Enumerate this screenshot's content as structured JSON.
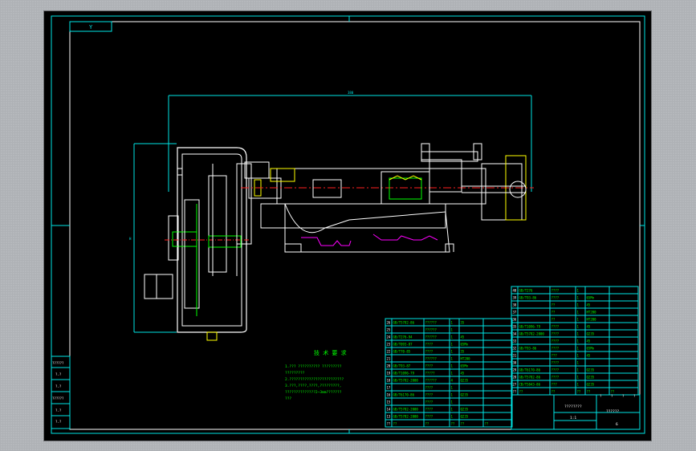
{
  "drawing": {
    "corner_label": "Y",
    "dimension_top": "380",
    "dimension_left": "H",
    "tech_title": "技 术 要 求",
    "tech_lines": [
      "1.??? ?????????? ?????????",
      "  ?????????",
      "2.?????????????????????????",
      "3.???,????,????,?????????,",
      "  ??????????????2~3mm???????",
      "  ???"
    ],
    "title_block": {
      "main_name": "????????",
      "scale_label": "1:1",
      "sheet_code": "??????",
      "right_marks": [
        "?",
        "?",
        "?",
        "?"
      ],
      "bottom_code": "6"
    },
    "left_marks": [
      "??????",
      "?.?",
      "?.?",
      "??????",
      "?.?",
      "?.?"
    ],
    "bom_left": [
      [
        "26",
        "GB/T5782-86",
        "??????",
        "1",
        "35",
        ""
      ],
      [
        "25",
        "",
        "??????",
        "1",
        "",
        ""
      ],
      [
        "24",
        "GB/T276-94",
        "??????",
        "1",
        "45",
        ""
      ],
      [
        "23",
        "GB/T093-87",
        "????",
        "1",
        "65Mn",
        ""
      ],
      [
        "22",
        "GB/T70-85",
        "????",
        "1",
        "35",
        ""
      ],
      [
        "21",
        "",
        "??????",
        "1",
        "HT200",
        ""
      ],
      [
        "20",
        "GB/T93-87",
        "????",
        "1",
        "65Mn",
        ""
      ],
      [
        "19",
        "GB/T1096-79",
        "?????",
        "1",
        "45",
        ""
      ],
      [
        "18",
        "GB/T5782-2000",
        "??????",
        "4",
        "Q235",
        ""
      ],
      [
        "17",
        "",
        "????",
        "1",
        "",
        ""
      ],
      [
        "16",
        "GB/T6170-86",
        "????",
        "1",
        "Q235",
        ""
      ],
      [
        "15",
        "",
        "????",
        "1",
        "",
        ""
      ],
      [
        "14",
        "GB/T5782-2000",
        "????",
        "1",
        "Q235",
        ""
      ],
      [
        "13",
        "GB/T5782-2000",
        "????",
        "1",
        "Q235",
        ""
      ]
    ],
    "bom_right": [
      [
        "40",
        "GB/T276",
        "????",
        "1",
        "",
        ""
      ],
      [
        "39",
        "GB/T93-86",
        "????",
        "1",
        "65Mn",
        ""
      ],
      [
        "38",
        "",
        "??",
        "1",
        "45",
        ""
      ],
      [
        "37",
        "",
        "??",
        "1",
        "HT200",
        ""
      ],
      [
        "36",
        "",
        "??",
        "1",
        "HT200",
        ""
      ],
      [
        "35",
        "GB/T1096-79",
        "????",
        "1",
        "45",
        ""
      ],
      [
        "34",
        "GB/T5782-2000",
        "????",
        "1",
        "Q235",
        ""
      ],
      [
        "33",
        "",
        "????",
        "1",
        "45",
        ""
      ],
      [
        "32",
        "GB/T93-86",
        "????",
        "1",
        "65Mn",
        ""
      ],
      [
        "31",
        "",
        "???",
        "1",
        "45",
        ""
      ],
      [
        "30",
        "",
        "????",
        "1",
        "",
        ""
      ],
      [
        "29",
        "GB/T6170-86",
        "????",
        "1",
        "Q235",
        ""
      ],
      [
        "28",
        "GB/T5782-86",
        "????",
        "1",
        "Q235",
        ""
      ],
      [
        "27",
        "CB/T5843-86",
        "???",
        "1",
        "Q235",
        ""
      ]
    ],
    "bom_header_left": [
      "??",
      "??",
      "??",
      "??",
      "??",
      "??"
    ],
    "bom_header_right": [
      "??",
      "??",
      "??",
      "??",
      "??",
      "??"
    ]
  }
}
